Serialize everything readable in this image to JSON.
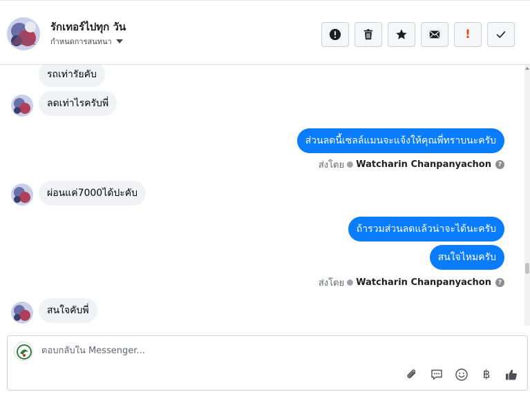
{
  "header": {
    "contact_name": "รักเทอร์ไปทุก วัน",
    "assign_label": "กำหนดการสนทนา",
    "tools": [
      {
        "icon": "alert-circle-icon",
        "label": "Mark as spam"
      },
      {
        "icon": "trash-icon",
        "label": "Delete"
      },
      {
        "icon": "star-icon",
        "label": "Star"
      },
      {
        "icon": "envelope-icon",
        "label": "Mark as unread"
      },
      {
        "icon": "exclamation-icon",
        "label": "Follow up",
        "glyph": "!"
      },
      {
        "icon": "check-icon",
        "label": "Mark as done"
      }
    ]
  },
  "messages": [
    {
      "direction": "in",
      "text": "รถเท่ารัยคับ"
    },
    {
      "direction": "in",
      "text": "ลดเท่าไรครับพี่"
    },
    {
      "direction": "out",
      "text": "ส่วนลดนี้เซลล์แมนจะแจ้งให้คุณพี่ทราบนะครับ"
    },
    {
      "direction": "sent_by",
      "prefix": "ส่งโดย",
      "name": "Watcharin Chanpanyachon",
      "help": "?"
    },
    {
      "direction": "in",
      "text": "ผ่อนแค่7000ได้ปะคับ"
    },
    {
      "direction": "out",
      "text": "ถ้ารวมส่วนลดแล้วน่าจะได้นะครับ"
    },
    {
      "direction": "out",
      "text": "สนใจไหมครับ"
    },
    {
      "direction": "sent_by",
      "prefix": "ส่งโดย",
      "name": "Watcharin Chanpanyachon",
      "help": "?"
    },
    {
      "direction": "in",
      "text": "สนใจคับพี่"
    }
  ],
  "composer": {
    "placeholder": "ตอบกลับใน Messenger...",
    "baht_glyph": "฿",
    "tools": [
      "paperclip-icon",
      "saved-replies-icon",
      "emoji-icon",
      "baht-icon",
      "thumbs-up-icon"
    ]
  },
  "colors": {
    "outgoing_bubble": "#0a7cff",
    "incoming_bubble": "#f0f2f5",
    "follow_up_accent": "#e04a1f"
  }
}
